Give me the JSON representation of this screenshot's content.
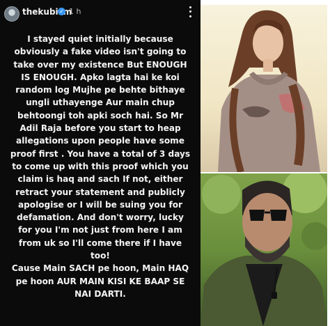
{
  "story": {
    "username": "thekubism",
    "time": "1 h",
    "text": "I stayed quiet initially because\nobviously a fake video isn't going to\ntake over my existence But ENOUGH\nIS ENOUGH. Apko lagta hai ke koi\nrandom log Mujhe pe behte bithaye\nungli uthayenge Aur main chup\nbehtoongi toh apki soch hai. So Mr\nAdil Raja before you start to heap\nallegations upon people have some\nproof first . You have a total of 3 days\nto come up with this proof which you\nclaim is haq and sach If not, either\nretract your statement and publicly\napologise or I will be suing you for\ndefamation. And don't worry, lucky\nfor you I'm not just from here I am\nfrom uk  so I'll come there if I have\ntoo!\nCause Main SACH pe hoon, Main HAQ\npe hoon AUR MAIN KISI KE BAAP SE\nNAI DARTI."
  },
  "icons": {
    "verified": "verified-badge-icon",
    "more": "more-options-icon"
  },
  "colors": {
    "story_bg": "#0b0b0b",
    "text": "#f4f4f4",
    "verified": "#3897f0"
  }
}
